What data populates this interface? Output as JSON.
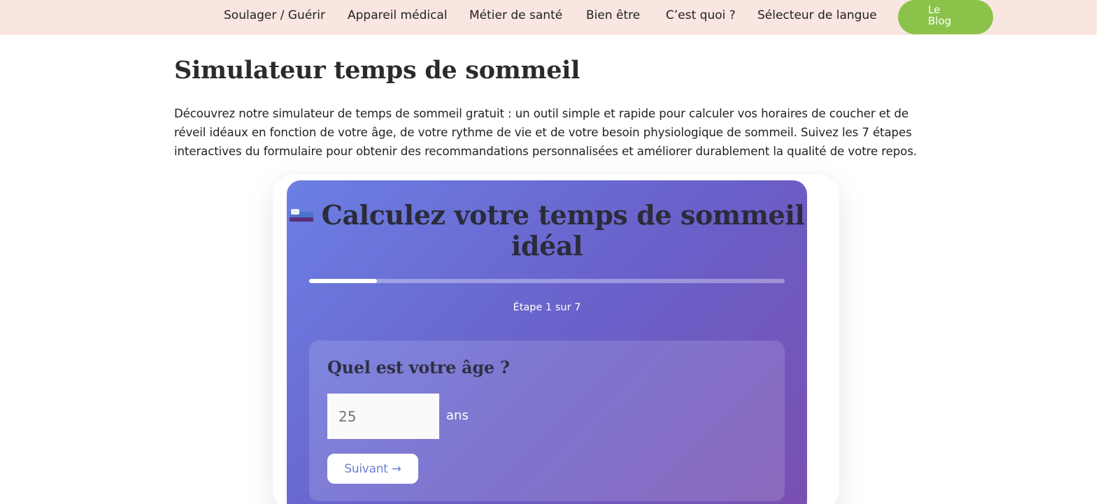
{
  "nav": {
    "items": [
      {
        "label": "Soulager / Guérir"
      },
      {
        "label": "Appareil médical"
      },
      {
        "label": "Métier de santé"
      },
      {
        "label": "Bien être"
      },
      {
        "label": "C’est quoi ?"
      },
      {
        "label": "Sélecteur de langue"
      }
    ],
    "blog_button": {
      "line1": "Le",
      "line2": "Blog"
    }
  },
  "page": {
    "title": "Simulateur temps de sommeil",
    "intro": "Découvrez notre simulateur de temps de sommeil gratuit : un outil simple et rapide pour calculer vos horaires de coucher et de réveil idéaux en fonction de votre âge, de votre rythme de vie et de votre besoin physiologique de sommeil. Suivez les 7 étapes interactives du formulaire pour obtenir des recommandations personnalisées et améliorer durablement la qualité de votre repos."
  },
  "calculator": {
    "icon": "bed-icon",
    "title": "Calculez votre temps de sommeil idéal",
    "progress": 0.1428,
    "step_text": "Étape 1 sur 7",
    "question": "Quel est votre âge ?",
    "age_placeholder": "25",
    "unit": "ans",
    "next_label": "Suivant →"
  },
  "colors": {
    "topbar_bg": "#f9e6e1",
    "blog_button": "#8bc34a",
    "gradient_start": "#6b7fe3",
    "gradient_end": "#7a4fb0"
  }
}
